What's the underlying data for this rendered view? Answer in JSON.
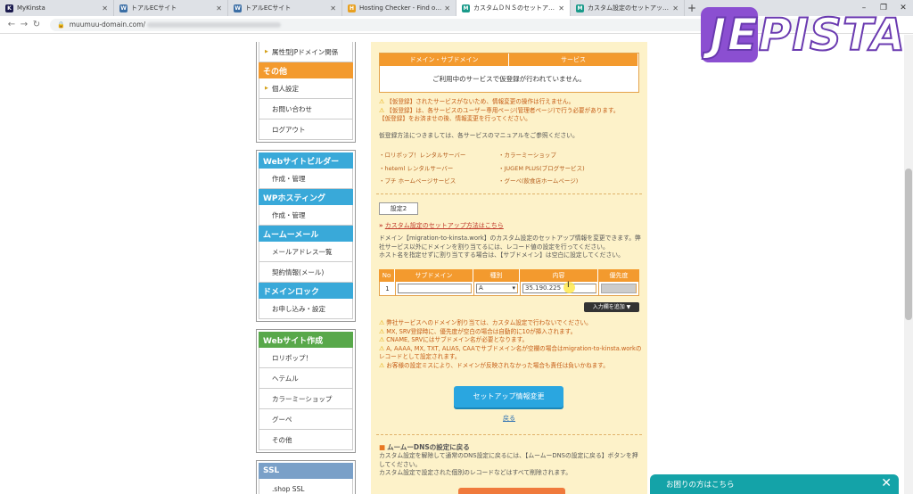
{
  "browser": {
    "tabs": [
      {
        "label": "MyKinsta",
        "favicon": "K",
        "color": "#1a1a4e",
        "active": false
      },
      {
        "label": "トアルECサイト",
        "favicon": "W",
        "color": "#3b6ea5",
        "active": false
      },
      {
        "label": "トアルECサイト",
        "favicon": "W",
        "color": "#3b6ea5",
        "active": false
      },
      {
        "label": "Hosting Checker - Find out who",
        "favicon": "H",
        "color": "#e8a020",
        "active": false
      },
      {
        "label": "カスタムＤＮＳのセットアップ情報変",
        "favicon": "M",
        "color": "#1a9a8a",
        "active": true
      },
      {
        "label": "カスタム設定のセットアップ方法 - ム",
        "favicon": "M",
        "color": "#1a9a8a",
        "active": false
      }
    ],
    "url": "muumuu-domain.com/",
    "window_controls": [
      "–",
      "❐",
      "✕"
    ]
  },
  "watermark": {
    "text": "JEPISTA"
  },
  "sidebar": {
    "top_items": [
      {
        "label": "属性型JPドメイン関係",
        "arrow": true
      }
    ],
    "sonota_head": "その他",
    "sonota_items": [
      {
        "label": "個人設定",
        "arrow": true
      },
      {
        "label": "お問い合わせ",
        "arrow": false
      },
      {
        "label": "ログアウト",
        "arrow": false
      }
    ],
    "group1": [
      {
        "head": "Webサイトビルダー",
        "items": [
          "作成・管理"
        ]
      },
      {
        "head": "WPホスティング",
        "items": [
          "作成・管理"
        ]
      },
      {
        "head": "ムームーメール",
        "items": [
          "メールアドレス一覧",
          "契約情報(メール)"
        ]
      },
      {
        "head": "ドメインロック",
        "items": [
          "お申し込み・設定"
        ]
      }
    ],
    "group2": {
      "head": "Webサイト作成",
      "items": [
        "ロリポップ！",
        "ヘテムル",
        "カラーミーショップ",
        "グーペ",
        "その他"
      ]
    },
    "group3": {
      "head": "SSL",
      "items": [
        ".shop SSL"
      ]
    }
  },
  "main": {
    "table1": {
      "headers": [
        "ドメイン・サブドメイン",
        "サービス"
      ],
      "empty_text": "ご利用中のサービスで仮登録が行われていません。"
    },
    "warnings1": [
      "【仮登録】されたサービスがないため、情報変更の操作は行えません。",
      "【仮登録】は、各サービスのユーザー専用ページ(管理者ページ)で行う必要があります。",
      "【仮登録】をお済ませの後、情報変更を行ってください。"
    ],
    "manual_text": "仮登録方法につきましては、各サービスのマニュアルをご参照ください。",
    "services": [
      "・ロリポップ！レンタルサーバー",
      "・カラーミーショップ",
      "・heteml レンタルサーバー",
      "・JUGEM PLUS(ブログサービス)",
      "・プチ ホームページサービス",
      "・グーペ(飲食店ホームページ)"
    ],
    "settei_label": "設定2",
    "custom_link": "カスタム設定のセットアップ方法はこちら",
    "desc": [
      "ドメイン【migration-to-kinsta.work】のカスタム設定のセットアップ情報を変更できます。弊社サービス以外にドメインを割り当てるには、レコード値の設定を行ってください。",
      "ホスト名を指定せずに割り当てする場合は、【サブドメイン】は空白に設定してください。"
    ],
    "table2": {
      "headers": [
        "No",
        "サブドメイン",
        "種別",
        "内容",
        "優先度"
      ],
      "row": {
        "no": "1",
        "subdomain": "",
        "type": "A",
        "content": "35.190.225",
        "priority": ""
      }
    },
    "add_row_label": "入力欄を追加 ▼",
    "warnings2": [
      "弊社サービスへのドメイン割り当ては、カスタム設定で行わないでください。",
      "MX, SRV登録時に、優先度が空白の場合は自動的に10が挿入されます。",
      "CNAME, SRVにはサブドメイン名が必要となります。",
      "A, AAAA, MX, TXT, ALIAS, CAAでサブドメイン名が空欄の場合はmigration-to-kinsta.workのレコードとして設定されます。",
      "お客様の設定ミスにより、ドメインが反映されなかった場合も責任は負いかねます。"
    ],
    "submit_label": "セットアップ情報変更",
    "back_label": "戻る",
    "dns_head": "ムームーDNSの設定に戻る",
    "dns_text": [
      "カスタム設定を解除して通常のDNS設定に戻るには、【ムームーDNSの設定に戻る】ボタンを押してください。",
      "カスタム設定で設定された個別のレコードなどはすべて削除されます。"
    ]
  },
  "chat": {
    "label": "お困りの方はこちら"
  }
}
